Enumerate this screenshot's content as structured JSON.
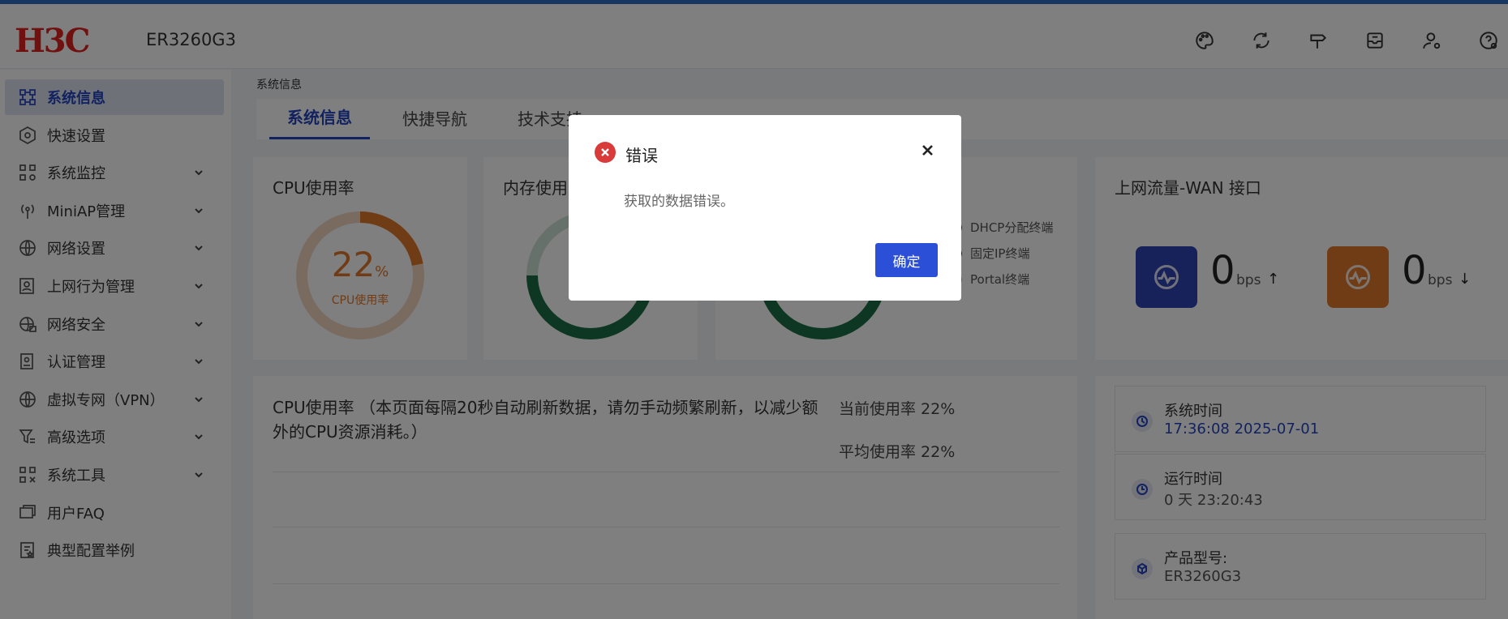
{
  "header": {
    "model": "ER3260G3",
    "icons": [
      "palette-icon",
      "sync-icon",
      "signpost-icon",
      "inbox-icon",
      "user-icon",
      "help-icon"
    ]
  },
  "sidebar": {
    "items": [
      {
        "label": "系统信息",
        "icon": "grid-nodes-icon",
        "active": true
      },
      {
        "label": "快速设置",
        "icon": "hexagon-icon"
      },
      {
        "label": "系统监控",
        "icon": "monitor-nodes-icon",
        "expandable": true
      },
      {
        "label": "MiniAP管理",
        "icon": "antenna-icon",
        "expandable": true
      },
      {
        "label": "网络设置",
        "icon": "globe-icon",
        "expandable": true
      },
      {
        "label": "上网行为管理",
        "icon": "user-card-icon",
        "expandable": true
      },
      {
        "label": "网络安全",
        "icon": "globe-lock-icon",
        "expandable": true
      },
      {
        "label": "认证管理",
        "icon": "id-card-icon",
        "expandable": true
      },
      {
        "label": "虚拟专网（VPN）",
        "icon": "vpn-globe-icon",
        "expandable": true
      },
      {
        "label": "高级选项",
        "icon": "filter-icon",
        "expandable": true
      },
      {
        "label": "系统工具",
        "icon": "tools-icon",
        "expandable": true
      },
      {
        "label": "用户FAQ",
        "icon": "chat-icon"
      },
      {
        "label": "典型配置举例",
        "icon": "star-doc-icon"
      }
    ]
  },
  "breadcrumb": "系统信息",
  "tabs": [
    {
      "label": "系统信息",
      "active": true
    },
    {
      "label": "快捷导航"
    },
    {
      "label": "技术支持"
    }
  ],
  "cpu_card": {
    "title": "CPU使用率",
    "value": "22",
    "unit": "%",
    "caption": "CPU使用率",
    "fraction": 0.22
  },
  "mem_card": {
    "title": "内存使用率"
  },
  "terminal_card": {
    "legend": [
      {
        "label": "DHCP分配终端",
        "color": "#1a6f47"
      },
      {
        "label": "固定IP终端",
        "color": "#2545c0"
      },
      {
        "label": "Portal终端",
        "color": "#e6b422"
      }
    ]
  },
  "wan_card": {
    "title": "上网流量-WAN 接口",
    "up": {
      "value": "0",
      "unit": "bps"
    },
    "down": {
      "value": "0",
      "unit": "bps"
    }
  },
  "cpu_detail": {
    "title": "CPU使用率 （本页面每隔20秒自动刷新数据，请勿手动频繁刷新，以减少额外的CPU资源消耗。）",
    "current_label": "当前使用率 22%",
    "average_label": "平均使用率 22%"
  },
  "sysinfo": {
    "time_label": "系统时间",
    "time_value": "17:36:08 2025-07-01",
    "uptime_label": "运行时间",
    "uptime_value": "0 天  23:20:43",
    "product_label": "产品型号:",
    "product_value": "ER3260G3"
  },
  "dialog": {
    "title": "错误",
    "message": "获取的数据错误。",
    "ok_label": "确定"
  },
  "colors": {
    "accent": "#2545c0",
    "cpu_orange": "#e0782a",
    "mem_green": "#1a6f47",
    "logo_red": "#e0211e",
    "error_red": "#d93a3a"
  }
}
